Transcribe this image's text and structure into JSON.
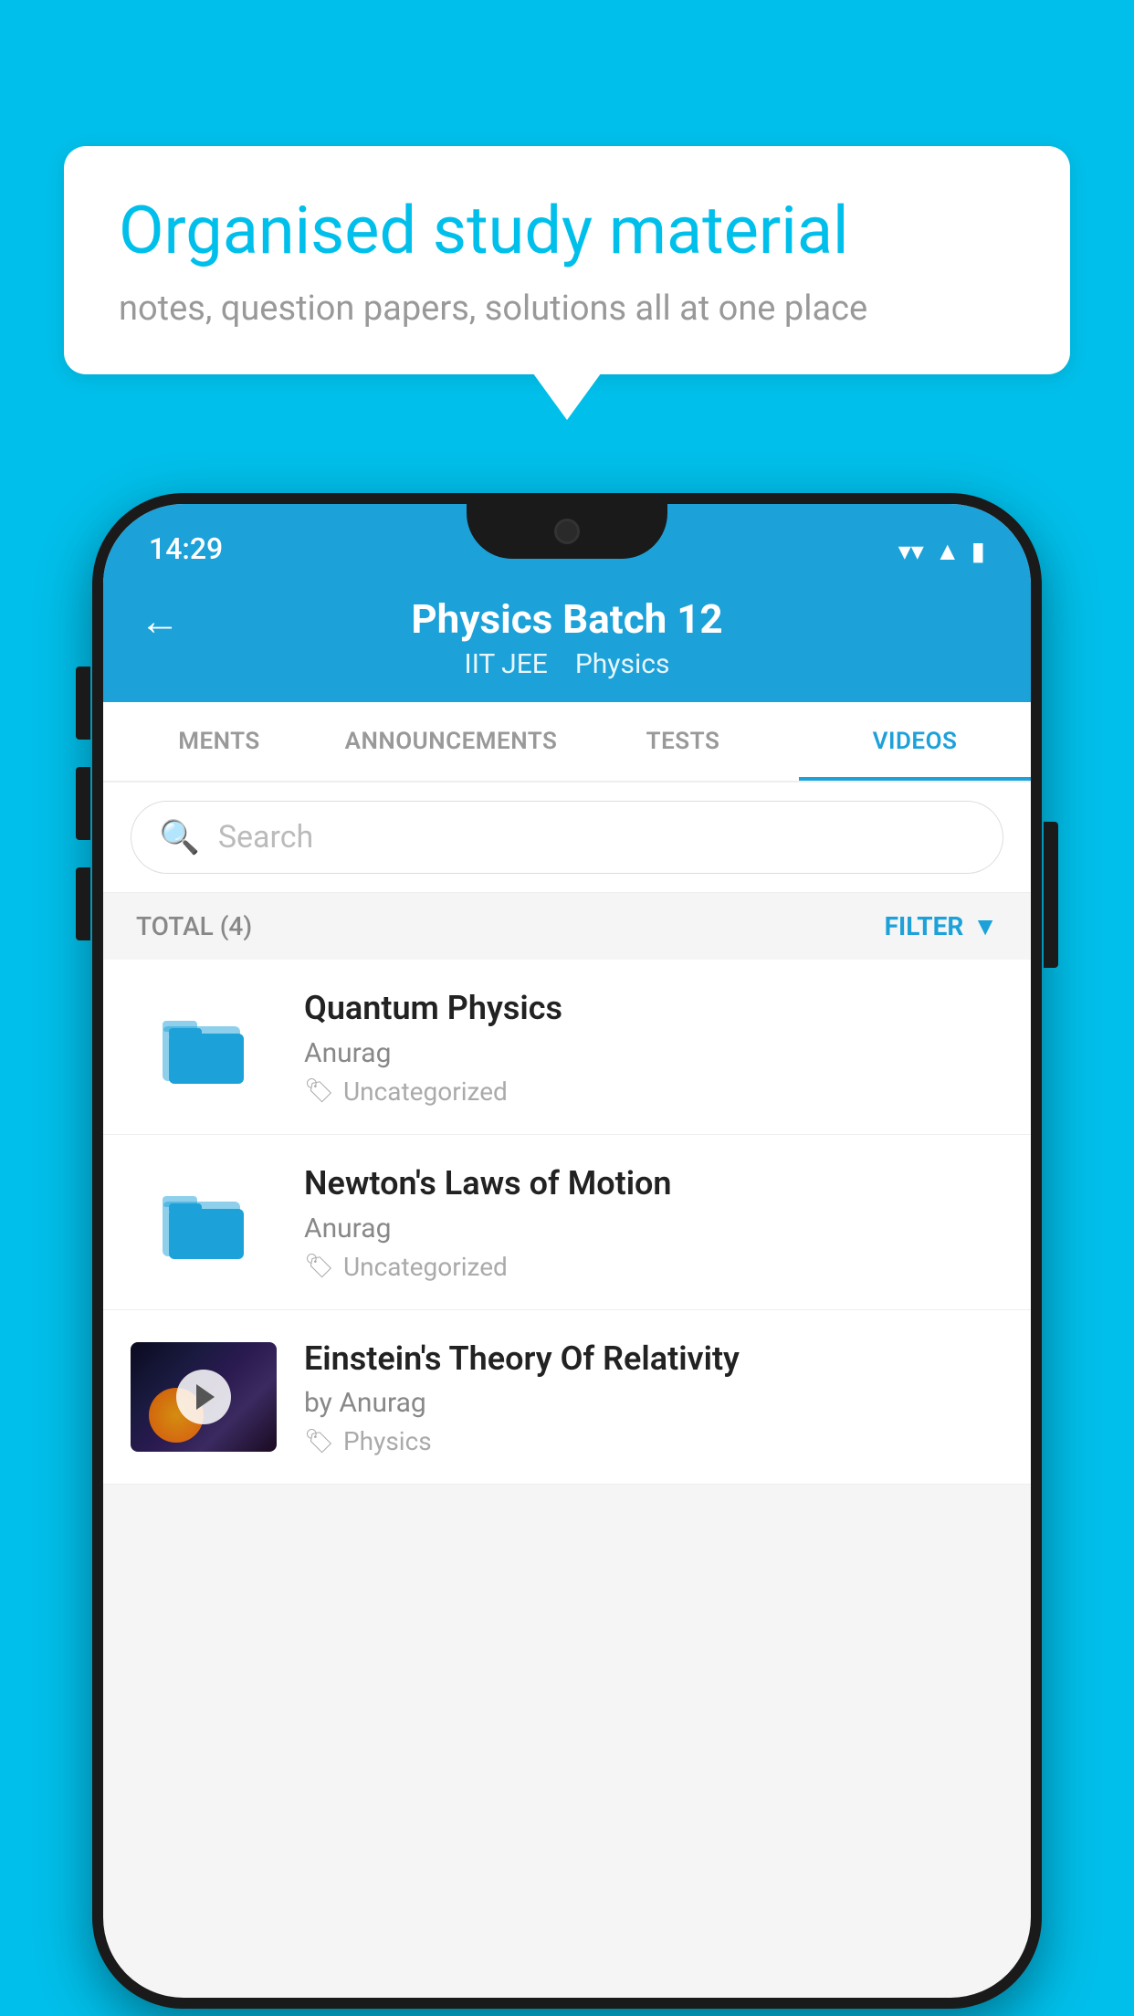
{
  "background_color": "#00BFEA",
  "speech_bubble": {
    "title": "Organised study material",
    "subtitle": "notes, question papers, solutions all at one place"
  },
  "phone": {
    "status_bar": {
      "time": "14:29"
    },
    "header": {
      "title": "Physics Batch 12",
      "subtitle1": "IIT JEE",
      "subtitle2": "Physics",
      "back_label": "←"
    },
    "tabs": [
      {
        "label": "MENTS",
        "active": false
      },
      {
        "label": "ANNOUNCEMENTS",
        "active": false
      },
      {
        "label": "TESTS",
        "active": false
      },
      {
        "label": "VIDEOS",
        "active": true
      }
    ],
    "search": {
      "placeholder": "Search"
    },
    "filter_bar": {
      "total_label": "TOTAL (4)",
      "filter_label": "FILTER"
    },
    "videos": [
      {
        "id": 1,
        "title": "Quantum Physics",
        "author": "Anurag",
        "tag": "Uncategorized",
        "has_thumbnail": false
      },
      {
        "id": 2,
        "title": "Newton's Laws of Motion",
        "author": "Anurag",
        "tag": "Uncategorized",
        "has_thumbnail": false
      },
      {
        "id": 3,
        "title": "Einstein's Theory Of Relativity",
        "author": "by Anurag",
        "tag": "Physics",
        "has_thumbnail": true
      }
    ]
  }
}
